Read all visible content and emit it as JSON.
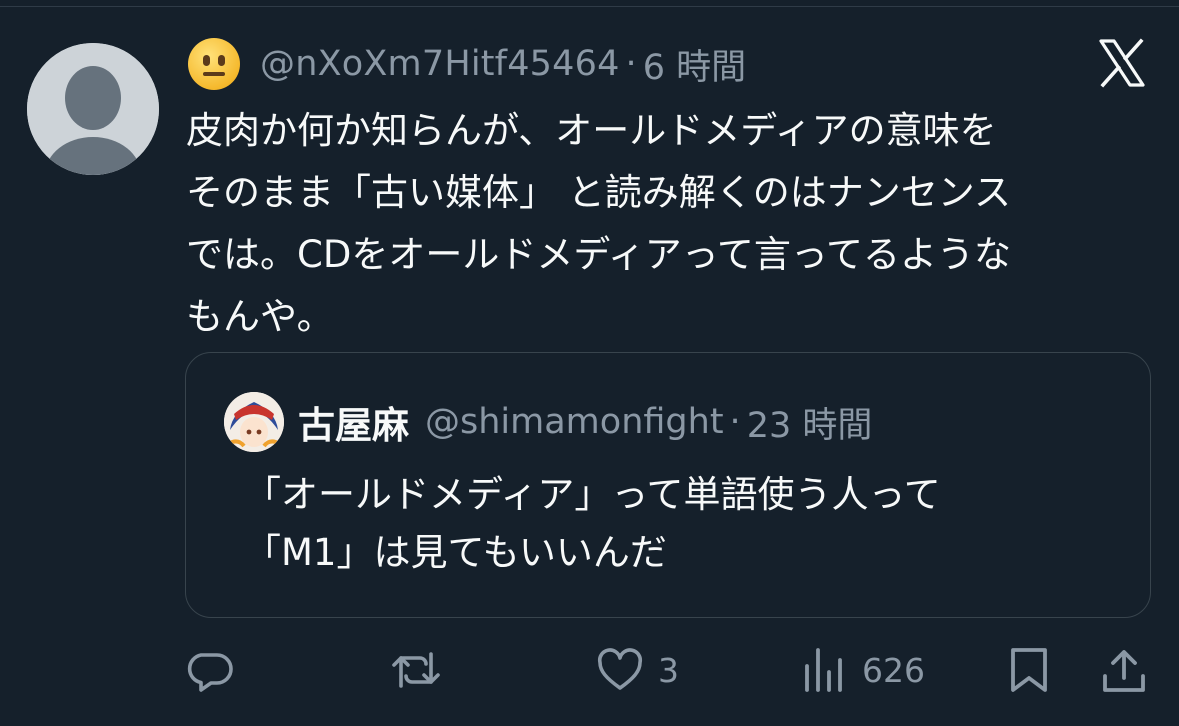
{
  "tweet": {
    "emoji": "neutral-face",
    "handle": "@nXoXm7Hitf45464",
    "separator": "·",
    "time": "6 時間",
    "text_lines": [
      "皮肉か何か知らんが、オールドメディアの意味を",
      "そのまま「古い媒体」 と読み解くのはナンセンス",
      "では。CDをオールドメディアって言ってるような",
      "もんや。"
    ]
  },
  "quote": {
    "name": "古屋麻",
    "handle": "@shimamonfight",
    "separator": "·",
    "time": "23 時間",
    "text_lines": [
      "「オールドメディア」って単語使う人って",
      "「M1」は見てもいいんだ"
    ]
  },
  "actions": {
    "reply_icon": "speech-bubble-icon",
    "retweet_icon": "retweet-icon",
    "like_icon": "heart-icon",
    "like_count": "3",
    "views_icon": "bar-chart-icon",
    "views_count": "626",
    "bookmark_icon": "bookmark-icon",
    "share_icon": "share-icon"
  },
  "colors": {
    "background": "#15202b",
    "text": "#f7f9f9",
    "secondary": "#8b98a5",
    "border": "#38444d"
  }
}
